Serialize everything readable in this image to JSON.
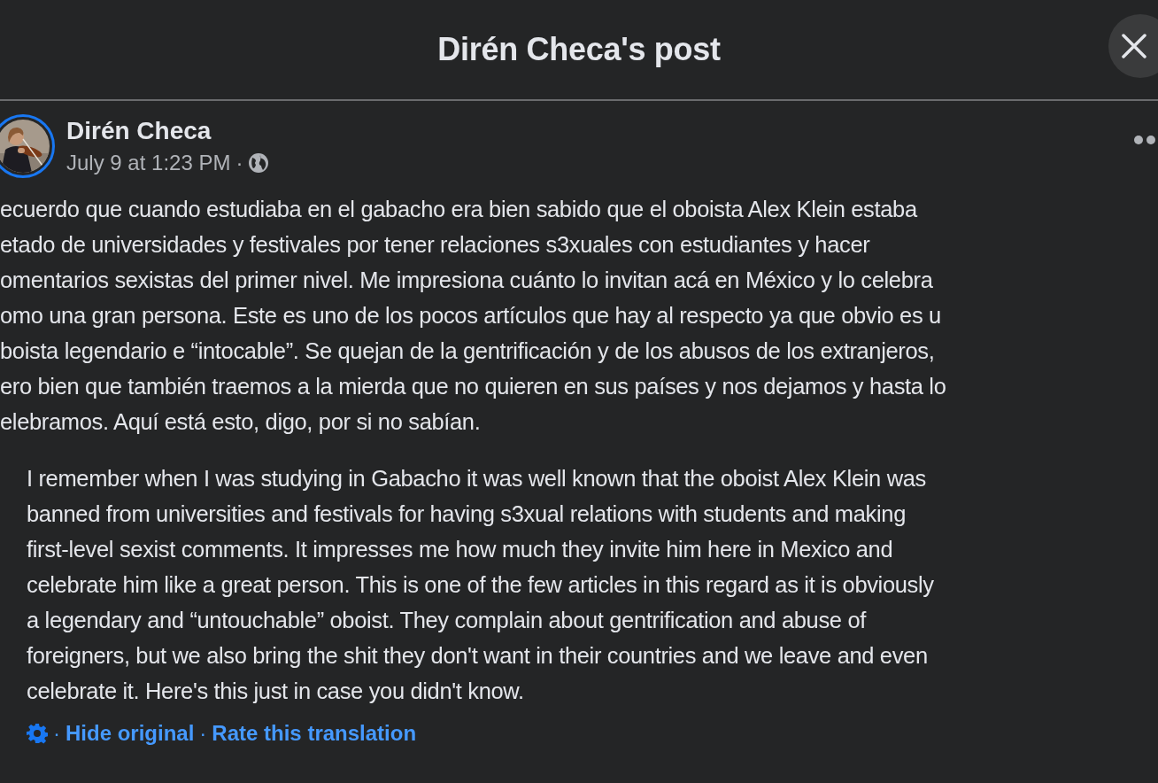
{
  "dialog": {
    "title": "Dirén Checa's post"
  },
  "post": {
    "author": "Dirén Checa",
    "timestamp": "July 9 at 1:23 PM",
    "meta_separator": "·",
    "original_lines": [
      "ecuerdo que cuando estudiaba en el gabacho era bien sabido que el oboista Alex Klein estaba",
      "etado de universidades y festivales por tener relaciones s3xuales con estudiantes y hacer",
      "omentarios sexistas del primer nivel. Me impresiona cuánto lo invitan acá en México y lo celebra",
      "omo una gran persona. Este es uno de los pocos artículos que hay al respecto ya que obvio es u",
      "boista legendario e “intocable”. Se quejan de la gentrificación y de los abusos de los extranjeros,",
      "ero bien que también traemos a la mierda que no quieren en sus países y nos dejamos y hasta lo",
      "elebramos. Aquí está esto, digo, por si no sabían."
    ],
    "translation_lines": [
      "I remember when I was studying in Gabacho it was well known that the oboist Alex Klein was",
      "banned from universities and festivals for having s3xual relations with students and making",
      "first-level sexist comments. It impresses me how much they invite him here in Mexico and",
      "celebrate him like a great person. This is one of the few articles in this regard as it is obviously",
      "a legendary and “untouchable” oboist. They complain about gentrification and abuse of",
      "foreigners, but we also bring the shit they don't want in their countries and we leave and even",
      "celebrate it. Here's this just in case you didn't know."
    ],
    "translation_actions": [
      {
        "kind": "separator",
        "text": "·"
      },
      {
        "kind": "link",
        "text": "Hide original"
      },
      {
        "kind": "separator",
        "text": "·"
      },
      {
        "kind": "link",
        "text": "Rate this translation"
      }
    ]
  }
}
